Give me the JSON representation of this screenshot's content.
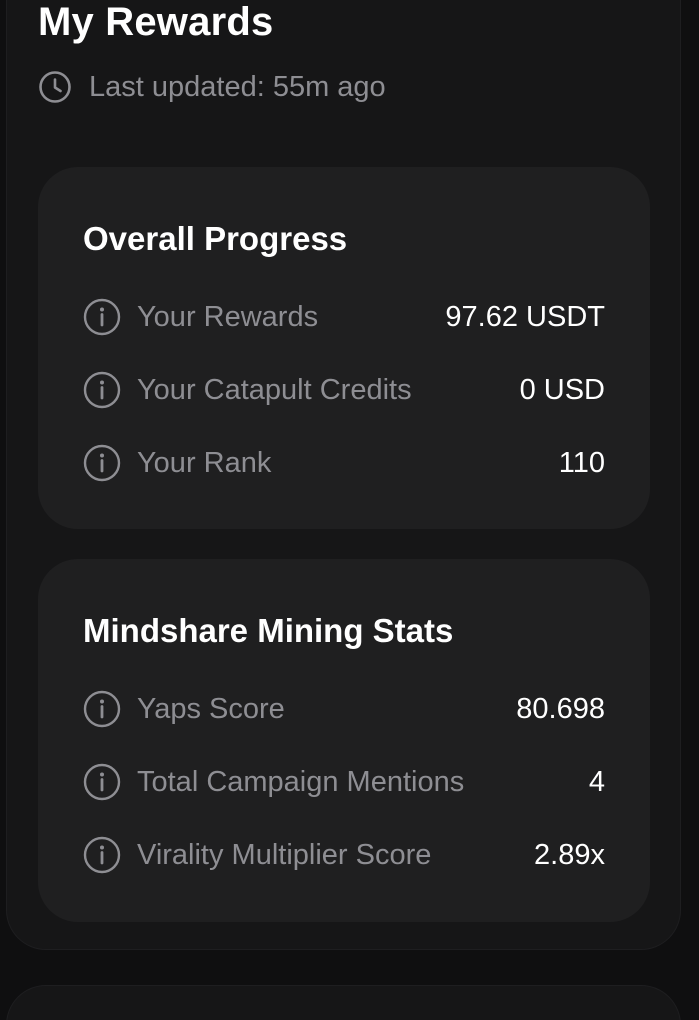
{
  "header": {
    "title": "My Rewards",
    "last_updated": "Last updated: 55m ago"
  },
  "overall_progress": {
    "title": "Overall Progress",
    "rows": [
      {
        "label": "Your Rewards",
        "value": "97.62 USDT"
      },
      {
        "label": "Your Catapult Credits",
        "value": "0 USD"
      },
      {
        "label": "Your Rank",
        "value": "110"
      }
    ]
  },
  "mindshare_mining": {
    "title": "Mindshare Mining Stats",
    "rows": [
      {
        "label": "Yaps Score",
        "value": "80.698"
      },
      {
        "label": "Total Campaign Mentions",
        "value": "4"
      },
      {
        "label": "Virality Multiplier Score",
        "value": "2.89x"
      }
    ]
  },
  "icons": {
    "clock": "clock-icon",
    "info": "info-icon"
  },
  "colors": {
    "background": "#0f0f10",
    "card": "#161617",
    "inner_card": "#1f1f20",
    "muted_text": "#8e8e93",
    "primary_text": "#ffffff"
  }
}
